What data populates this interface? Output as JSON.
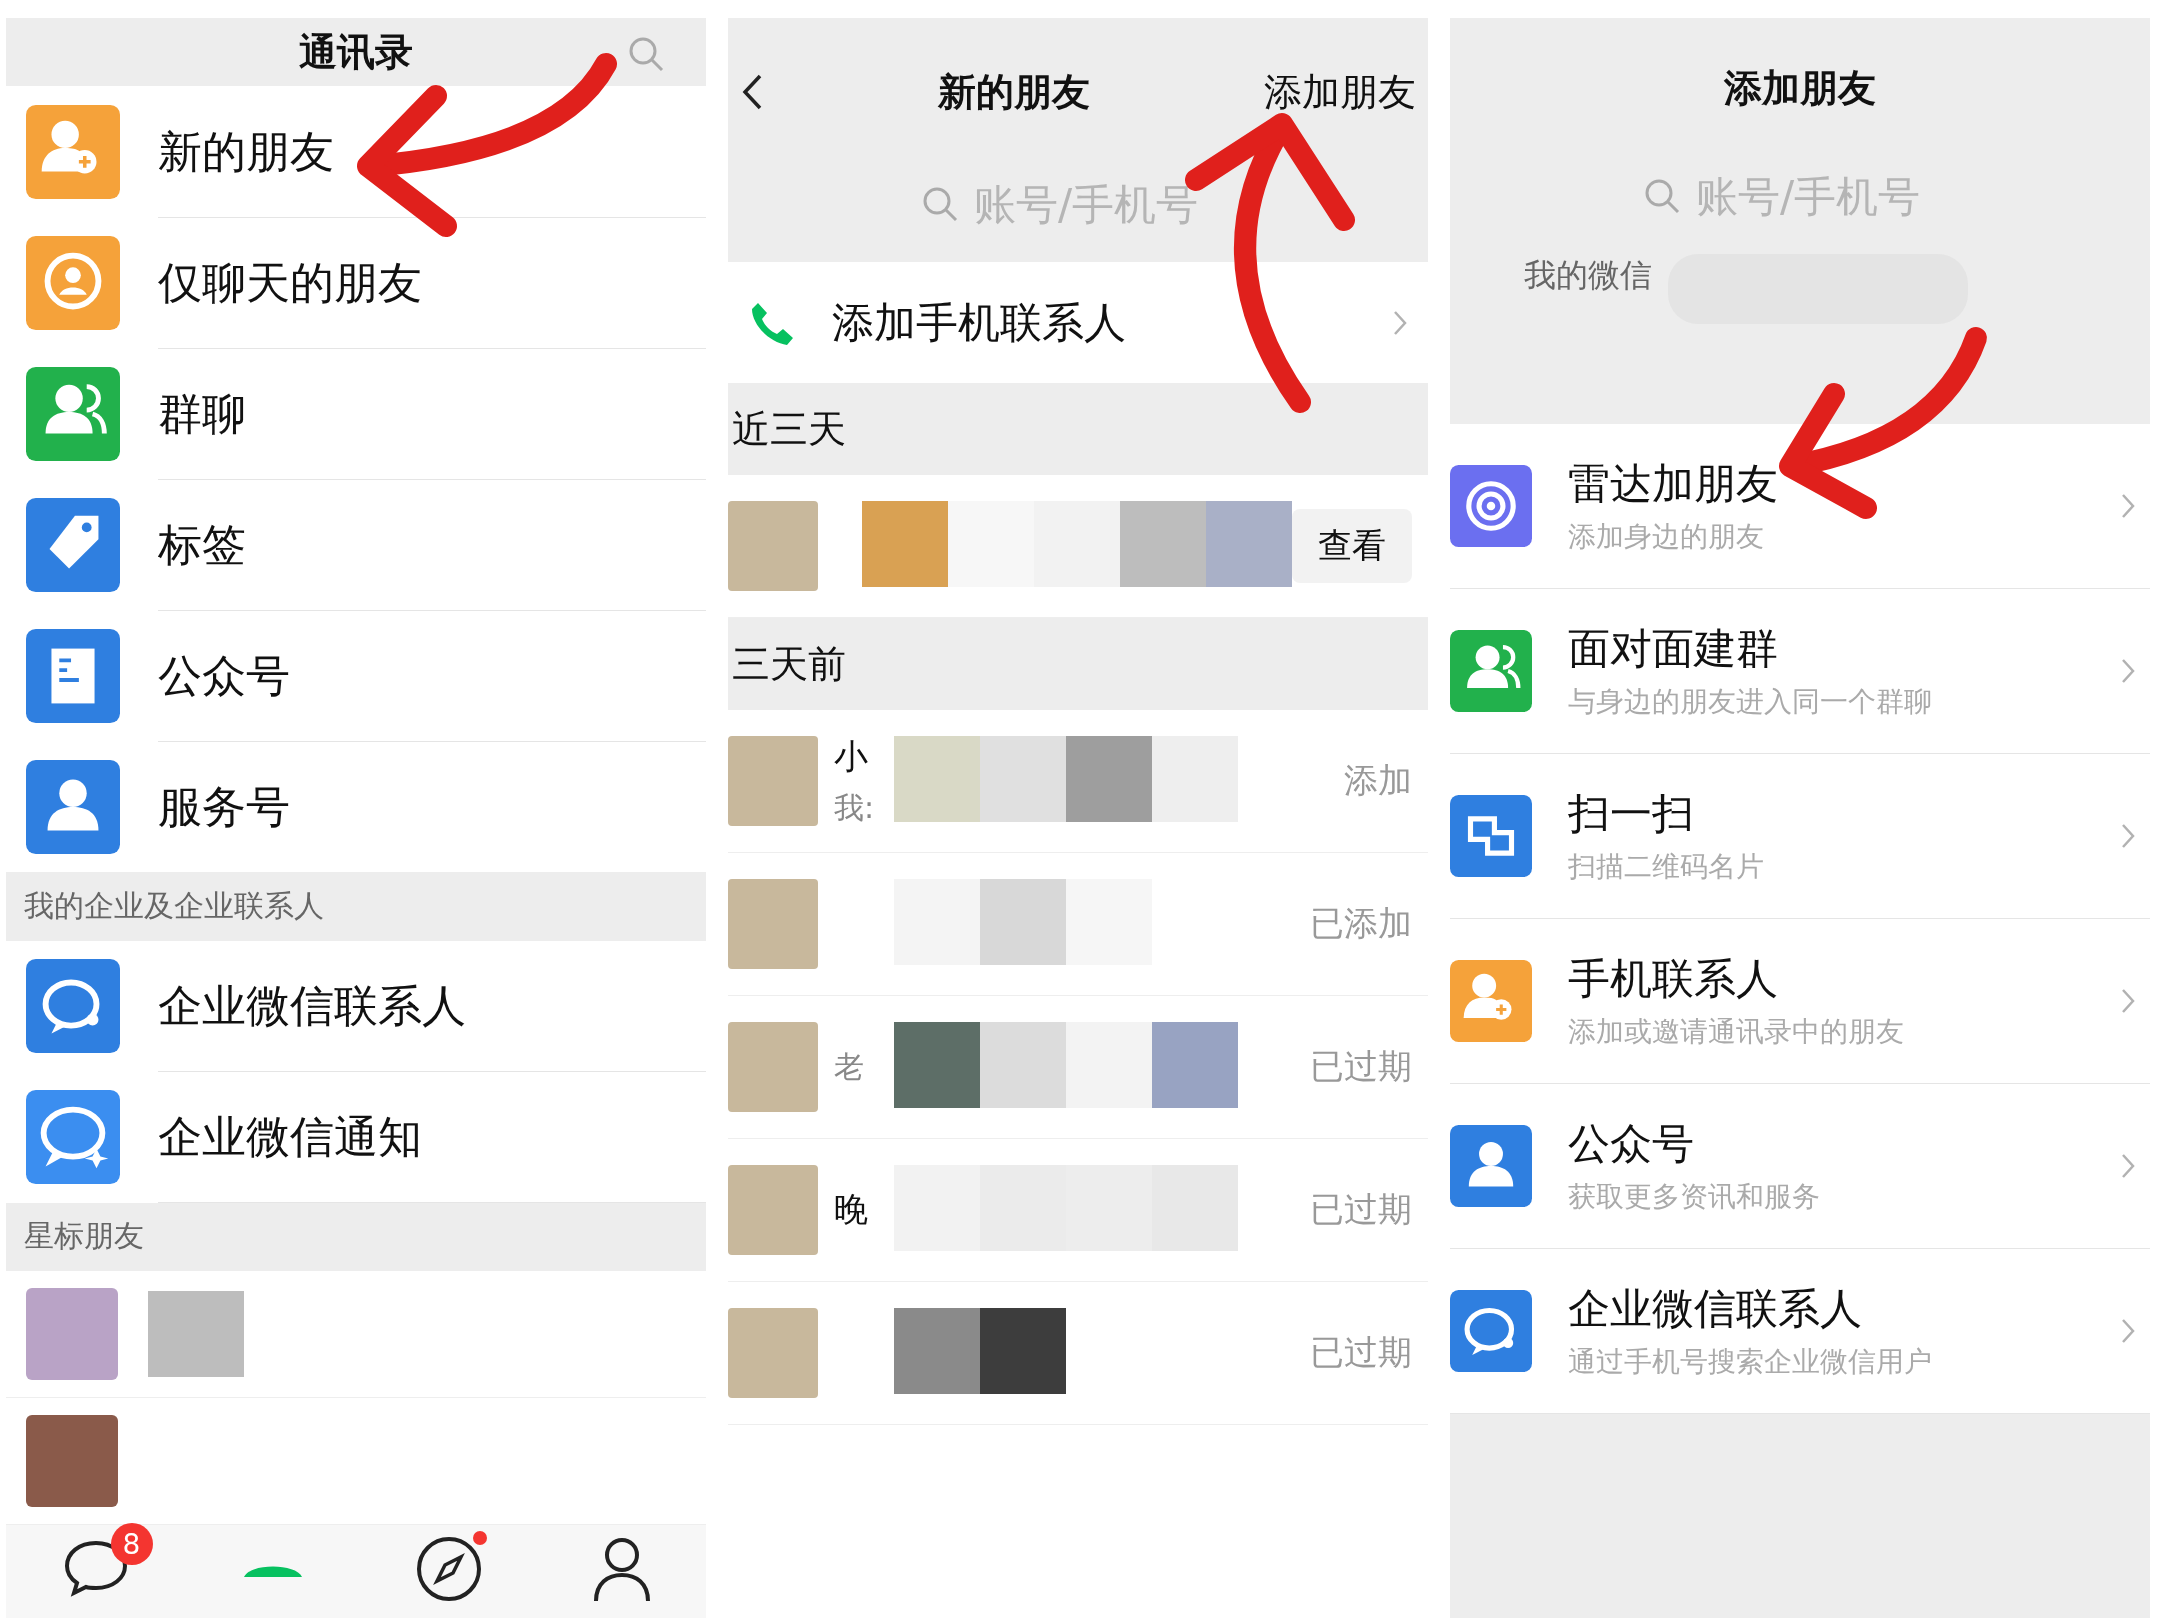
{
  "contacts_panel": {
    "title": "通讯录",
    "items": [
      {
        "label": "新的朋友",
        "kind": "adduser",
        "color": "#f5a23a"
      },
      {
        "label": "仅聊天的朋友",
        "kind": "chatonly",
        "color": "#f5a23a"
      },
      {
        "label": "群聊",
        "kind": "group",
        "color": "#22b14c"
      },
      {
        "label": "标签",
        "kind": "tag",
        "color": "#2f7fe0"
      },
      {
        "label": "公众号",
        "kind": "article",
        "color": "#2f7fe0"
      },
      {
        "label": "服务号",
        "kind": "person",
        "color": "#2f7fe0"
      }
    ],
    "enterprise_section": "我的企业及企业联系人",
    "enterprise_items": [
      {
        "label": "企业微信联系人",
        "kind": "enterprise",
        "color": "#2f7fe0"
      },
      {
        "label": "企业微信通知",
        "kind": "notify",
        "color": "#3b8ef0"
      }
    ],
    "starred_section": "星标朋友",
    "tab_bar": {
      "chats_badge": "8",
      "discover_dot": true
    }
  },
  "new_friends_panel": {
    "title": "新的朋友",
    "add_button": "添加朋友",
    "search": {
      "placeholder": "账号/手机号"
    },
    "add_phone_contacts": "添加手机联系人",
    "groups": [
      {
        "title": "近三天",
        "requests": [
          {
            "status": "查看",
            "kind": "button"
          }
        ]
      },
      {
        "title": "三天前",
        "requests": [
          {
            "name": "小",
            "message": "我:",
            "status": "添加",
            "kind": "text"
          },
          {
            "status": "已添加",
            "kind": "text"
          },
          {
            "message": "老",
            "status": "已过期",
            "kind": "text"
          },
          {
            "name": "晚",
            "status": "已过期",
            "kind": "text"
          },
          {
            "status": "已过期",
            "kind": "text"
          }
        ]
      }
    ]
  },
  "add_friends_panel": {
    "title": "添加朋友",
    "search": {
      "placeholder": "账号/手机号"
    },
    "my_id_label": "我的微信",
    "items": [
      {
        "title": "雷达加朋友",
        "subtitle": "添加身边的朋友",
        "kind": "radar",
        "color": "#6b6ff0"
      },
      {
        "title": "面对面建群",
        "subtitle": "与身边的朋友进入同一个群聊",
        "kind": "group",
        "color": "#22b14c"
      },
      {
        "title": "扫一扫",
        "subtitle": "扫描二维码名片",
        "kind": "scan",
        "color": "#2f7fe0"
      },
      {
        "title": "手机联系人",
        "subtitle": "添加或邀请通讯录中的朋友",
        "kind": "adduser",
        "color": "#f5a23a"
      },
      {
        "title": "公众号",
        "subtitle": "获取更多资讯和服务",
        "kind": "person",
        "color": "#2f7fe0"
      },
      {
        "title": "企业微信联系人",
        "subtitle": "通过手机号搜索企业微信用户",
        "kind": "enterprise",
        "color": "#2f7fe0"
      }
    ]
  }
}
